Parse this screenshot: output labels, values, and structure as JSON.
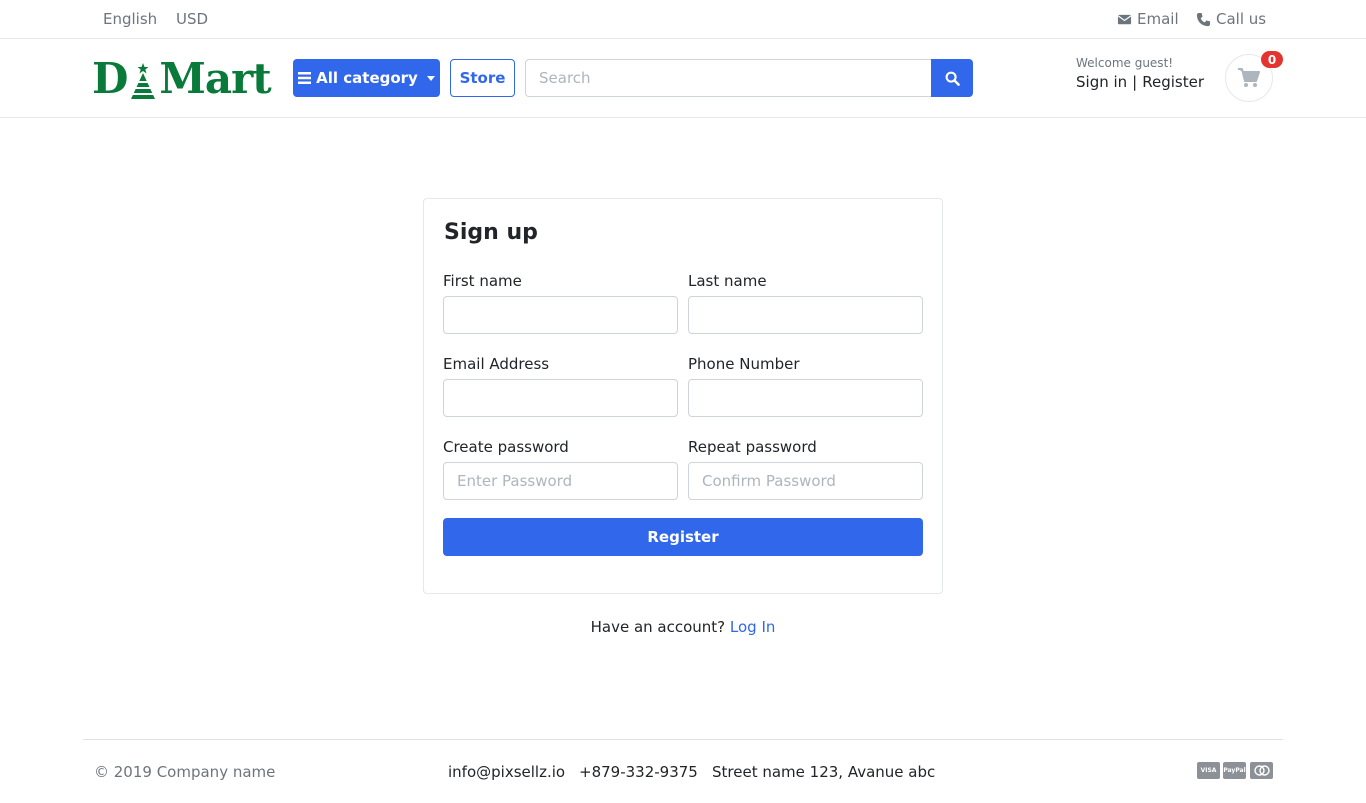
{
  "topbar": {
    "language": "English",
    "currency": "USD",
    "email_label": "Email",
    "call_label": "Call us"
  },
  "header": {
    "logo_text_left": "D",
    "logo_text_right": "Mart",
    "category_button": "All category",
    "store_button": "Store",
    "search_placeholder": "Search",
    "welcome": "Welcome guest!",
    "sign_in": "Sign in",
    "separator": "|",
    "register": "Register",
    "cart_count": "0"
  },
  "signup": {
    "title": "Sign up",
    "first_name_label": "First name",
    "last_name_label": "Last name",
    "email_label": "Email Address",
    "phone_label": "Phone Number",
    "create_password_label": "Create password",
    "create_password_placeholder": "Enter Password",
    "repeat_password_label": "Repeat password",
    "repeat_password_placeholder": "Confirm Password",
    "register_button": "Register"
  },
  "login_prompt": {
    "text": "Have an account?",
    "link": "Log In"
  },
  "footer": {
    "copyright": "© 2019 Company name",
    "email": "info@pixsellz.io",
    "phone": "+879-332-9375",
    "address": "Street name 123, Avanue abc",
    "payments": [
      "VISA",
      "PayPal",
      "MC"
    ]
  },
  "colors": {
    "primary": "#3167eb",
    "brand_green": "#0a7a3a",
    "badge_red": "#e3342f"
  }
}
